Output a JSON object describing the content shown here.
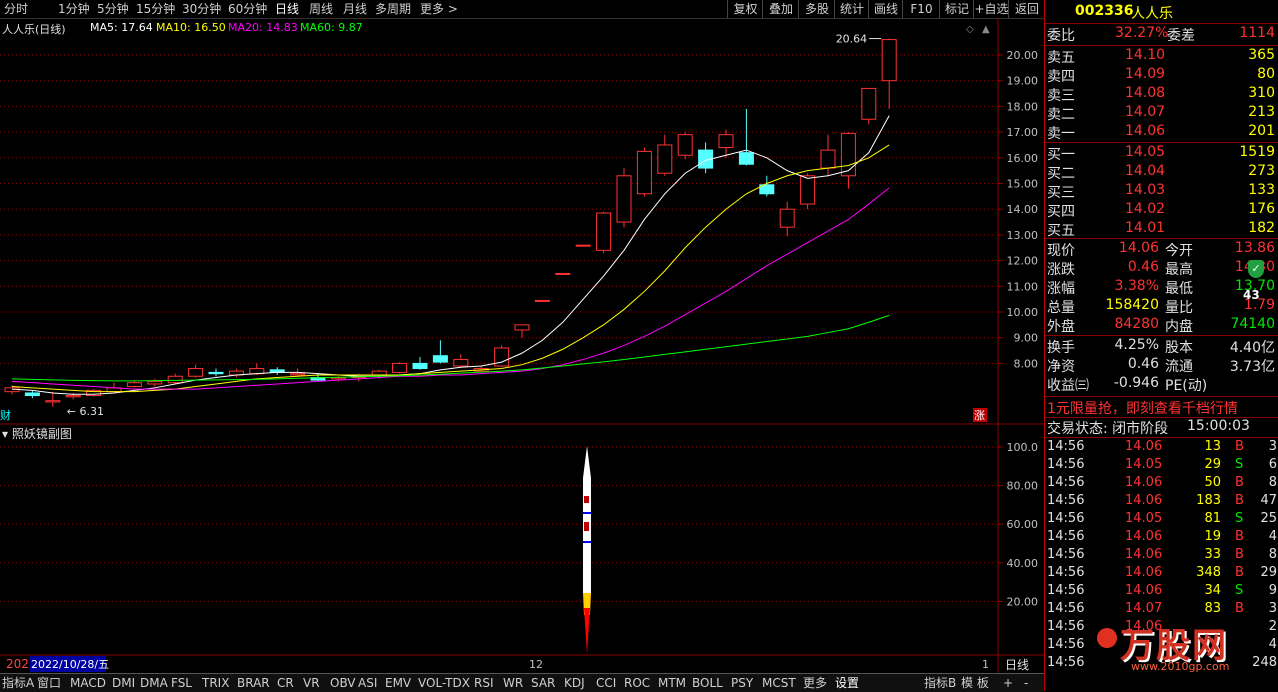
{
  "toolbar": {
    "periods": [
      "分时",
      "1分钟",
      "5分钟",
      "15分钟",
      "30分钟",
      "60分钟",
      "日线",
      "周线",
      "月线",
      "多周期",
      "更多 >"
    ],
    "buttons": [
      "复权",
      "叠加",
      "多股",
      "统计",
      "画线",
      "F10",
      "标记",
      "+自选",
      "返回"
    ]
  },
  "main_chart": {
    "title": "人人乐(日线)",
    "ma": [
      {
        "label": "MA5: 17.64",
        "color": "#ffffff"
      },
      {
        "label": "MA10: 16.50",
        "color": "#ffff00"
      },
      {
        "label": "MA20: 14.83",
        "color": "#ff00ff"
      },
      {
        "label": "MA60: 9.87",
        "color": "#00ff00"
      }
    ],
    "high_label": "20.64",
    "low_label": "6.31",
    "y_ticks": [
      "20.00",
      "19.00",
      "18.00",
      "17.00",
      "16.00",
      "15.00",
      "14.00",
      "13.00",
      "12.00",
      "11.00",
      "10.00",
      "9.00",
      "8.00"
    ],
    "marker_cai": "财",
    "marker_zhang": "涨"
  },
  "sub_chart": {
    "title": "照妖镜副图",
    "y_ticks": [
      "100.0",
      "80.00",
      "60.00",
      "40.00",
      "20.00"
    ]
  },
  "time_axis": {
    "left_label": "202",
    "date_label": "2022/10/28/五",
    "month_12": "12",
    "month_1": "1",
    "period_label": "日线"
  },
  "bottom_tabs": [
    "指标A",
    "窗口",
    "MACD",
    "DMI",
    "DMA",
    "FSL",
    "TRIX",
    "BRAR",
    "CR",
    "VR",
    "OBV",
    "ASI",
    "EMV",
    "VOL-TDX",
    "RSI",
    "WR",
    "SAR",
    "KDJ",
    "CCI",
    "ROC",
    "MTM",
    "BOLL",
    "PSY",
    "MCST",
    "更多",
    "设置"
  ],
  "bottom_right": [
    "指标B",
    "模 板",
    "+",
    "-",
    "I",
    "+",
    "-"
  ],
  "quote": {
    "code": "002336",
    "name": "人人乐",
    "weibi_label": "委比",
    "weibi": "32.27%",
    "weicha_label": "委差",
    "weicha": "1114",
    "asks": [
      {
        "label": "卖五",
        "price": "14.10",
        "vol": "365"
      },
      {
        "label": "卖四",
        "price": "14.09",
        "vol": "80"
      },
      {
        "label": "卖三",
        "price": "14.08",
        "vol": "310"
      },
      {
        "label": "卖二",
        "price": "14.07",
        "vol": "213"
      },
      {
        "label": "卖一",
        "price": "14.06",
        "vol": "201"
      }
    ],
    "bids": [
      {
        "label": "买一",
        "price": "14.05",
        "vol": "1519"
      },
      {
        "label": "买二",
        "price": "14.04",
        "vol": "273"
      },
      {
        "label": "买三",
        "price": "14.03",
        "vol": "133"
      },
      {
        "label": "买四",
        "price": "14.02",
        "vol": "176"
      },
      {
        "label": "买五",
        "price": "14.01",
        "vol": "182"
      }
    ],
    "stats": [
      {
        "l1": "现价",
        "v1": "14.06",
        "l2": "今开",
        "v2": "13.86"
      },
      {
        "l1": "涨跌",
        "v1": "0.46",
        "l2": "最高",
        "v2": "14.30"
      },
      {
        "l1": "涨幅",
        "v1": "3.38%",
        "l2": "最低",
        "v2": "13.70"
      },
      {
        "l1": "总量",
        "v1": "158420",
        "l2": "量比",
        "v2": "1.79"
      },
      {
        "l1": "外盘",
        "v1": "84280",
        "l2": "内盘",
        "v2": "74140"
      }
    ],
    "stats2": [
      {
        "l1": "换手",
        "v1": "4.25%",
        "l2": "股本",
        "v2": "4.40亿"
      },
      {
        "l1": "净资",
        "v1": "0.46",
        "l2": "流通",
        "v2": "3.73亿"
      },
      {
        "l1": "收益㈢",
        "v1": "-0.946",
        "l2": "PE(动)",
        "v2": ""
      }
    ],
    "badge_pct": "43",
    "ad_text": "1元限量抢，即刻查看千档行情",
    "status_label": "交易状态: 闭市阶段",
    "status_time": "15:00:03",
    "ticks": [
      {
        "t": "14:56",
        "p": "14.06",
        "v": "13",
        "bs": "B",
        "n": "3"
      },
      {
        "t": "14:56",
        "p": "14.05",
        "v": "29",
        "bs": "S",
        "n": "6"
      },
      {
        "t": "14:56",
        "p": "14.06",
        "v": "50",
        "bs": "B",
        "n": "8"
      },
      {
        "t": "14:56",
        "p": "14.06",
        "v": "183",
        "bs": "B",
        "n": "47"
      },
      {
        "t": "14:56",
        "p": "14.05",
        "v": "81",
        "bs": "S",
        "n": "25"
      },
      {
        "t": "14:56",
        "p": "14.06",
        "v": "19",
        "bs": "B",
        "n": "4"
      },
      {
        "t": "14:56",
        "p": "14.06",
        "v": "33",
        "bs": "B",
        "n": "8"
      },
      {
        "t": "14:56",
        "p": "14.06",
        "v": "348",
        "bs": "B",
        "n": "29"
      },
      {
        "t": "14:56",
        "p": "14.06",
        "v": "34",
        "bs": "S",
        "n": "9"
      },
      {
        "t": "14:56",
        "p": "14.07",
        "v": "83",
        "bs": "B",
        "n": "3"
      },
      {
        "t": "14:56",
        "p": "14.06",
        "v": "",
        "bs": "",
        "n": "2"
      },
      {
        "t": "14:56",
        "p": "",
        "v": "",
        "bs": "",
        "n": "4"
      },
      {
        "t": "14:56",
        "p": "",
        "v": "",
        "bs": "",
        "n": "248"
      }
    ],
    "watermark": "万股网",
    "watermark_url": "www.2010gp.com"
  },
  "colors": {
    "up": "#ff3232",
    "down": "#54ffff",
    "ma5": "#ffffff",
    "ma10": "#ffff00",
    "ma20": "#ff00ff",
    "ma60": "#00ff00",
    "grid": "#8b0000"
  },
  "chart_data": {
    "type": "candlestick",
    "ylim": [
      6.0,
      21.0
    ],
    "candles": [
      {
        "o": 6.9,
        "c": 7.05,
        "h": 7.15,
        "l": 6.8
      },
      {
        "o": 6.85,
        "c": 6.75,
        "h": 6.95,
        "l": 6.65
      },
      {
        "o": 6.5,
        "c": 6.55,
        "h": 6.9,
        "l": 6.31
      },
      {
        "o": 6.7,
        "c": 6.75,
        "h": 6.85,
        "l": 6.6
      },
      {
        "o": 6.75,
        "c": 6.95,
        "h": 7.0,
        "l": 6.7
      },
      {
        "o": 6.9,
        "c": 7.05,
        "h": 7.25,
        "l": 6.85
      },
      {
        "o": 7.1,
        "c": 7.25,
        "h": 7.35,
        "l": 7.05
      },
      {
        "o": 7.2,
        "c": 7.3,
        "h": 7.4,
        "l": 7.1
      },
      {
        "o": 7.25,
        "c": 7.5,
        "h": 7.6,
        "l": 7.2
      },
      {
        "o": 7.5,
        "c": 7.8,
        "h": 7.95,
        "l": 7.45
      },
      {
        "o": 7.65,
        "c": 7.6,
        "h": 7.8,
        "l": 7.5
      },
      {
        "o": 7.55,
        "c": 7.7,
        "h": 7.8,
        "l": 7.45
      },
      {
        "o": 7.6,
        "c": 7.8,
        "h": 8.0,
        "l": 7.55
      },
      {
        "o": 7.75,
        "c": 7.65,
        "h": 7.85,
        "l": 7.55
      },
      {
        "o": 7.55,
        "c": 7.6,
        "h": 7.8,
        "l": 7.5
      },
      {
        "o": 7.45,
        "c": 7.35,
        "h": 7.6,
        "l": 7.3
      },
      {
        "o": 7.4,
        "c": 7.45,
        "h": 7.5,
        "l": 7.3
      },
      {
        "o": 7.45,
        "c": 7.55,
        "h": 7.6,
        "l": 7.3
      },
      {
        "o": 7.55,
        "c": 7.7,
        "h": 7.75,
        "l": 7.4
      },
      {
        "o": 7.65,
        "c": 8.0,
        "h": 8.05,
        "l": 7.6
      },
      {
        "o": 8.0,
        "c": 7.8,
        "h": 8.25,
        "l": 7.75
      },
      {
        "o": 8.3,
        "c": 8.05,
        "h": 8.9,
        "l": 8.0
      },
      {
        "o": 7.9,
        "c": 8.15,
        "h": 8.35,
        "l": 7.85
      },
      {
        "o": 7.7,
        "c": 7.8,
        "h": 7.9,
        "l": 7.65
      },
      {
        "o": 7.9,
        "c": 8.6,
        "h": 8.7,
        "l": 7.85
      },
      {
        "o": 9.3,
        "c": 9.5,
        "h": 9.5,
        "l": 9.0
      },
      {
        "o": 10.45,
        "c": 10.45,
        "h": 10.45,
        "l": 10.45
      },
      {
        "o": 11.5,
        "c": 11.5,
        "h": 11.5,
        "l": 11.5
      },
      {
        "o": 12.6,
        "c": 12.6,
        "h": 12.6,
        "l": 12.6
      },
      {
        "o": 12.4,
        "c": 13.85,
        "h": 13.9,
        "l": 12.3
      },
      {
        "o": 13.5,
        "c": 15.3,
        "h": 15.6,
        "l": 13.3
      },
      {
        "o": 14.6,
        "c": 16.25,
        "h": 16.4,
        "l": 14.5
      },
      {
        "o": 15.4,
        "c": 16.5,
        "h": 16.9,
        "l": 15.3
      },
      {
        "o": 16.1,
        "c": 16.9,
        "h": 17.0,
        "l": 15.95
      },
      {
        "o": 16.3,
        "c": 15.6,
        "h": 16.6,
        "l": 15.4
      },
      {
        "o": 16.4,
        "c": 16.9,
        "h": 17.1,
        "l": 16.0
      },
      {
        "o": 16.2,
        "c": 15.75,
        "h": 17.9,
        "l": 15.7
      },
      {
        "o": 14.95,
        "c": 14.6,
        "h": 15.3,
        "l": 14.5
      },
      {
        "o": 13.3,
        "c": 14.0,
        "h": 14.3,
        "l": 12.95
      },
      {
        "o": 14.2,
        "c": 15.3,
        "h": 15.4,
        "l": 14.0
      },
      {
        "o": 15.6,
        "c": 16.3,
        "h": 16.9,
        "l": 15.3
      },
      {
        "o": 15.3,
        "c": 16.95,
        "h": 17.0,
        "l": 14.8
      },
      {
        "o": 17.5,
        "c": 18.7,
        "h": 18.7,
        "l": 17.3
      },
      {
        "o": 19.0,
        "c": 20.6,
        "h": 20.64,
        "l": 17.9
      }
    ],
    "ma5": [
      7.0,
      6.95,
      6.85,
      6.8,
      6.8,
      6.85,
      6.95,
      7.05,
      7.2,
      7.35,
      7.45,
      7.55,
      7.6,
      7.65,
      7.65,
      7.6,
      7.55,
      7.5,
      7.5,
      7.55,
      7.6,
      7.75,
      7.85,
      7.9,
      8.05,
      8.4,
      8.9,
      9.6,
      10.5,
      11.4,
      12.4,
      13.6,
      14.6,
      15.4,
      15.9,
      16.1,
      16.3,
      16.0,
      15.5,
      15.2,
      15.3,
      15.5,
      16.2,
      17.64
    ],
    "ma10": [
      7.1,
      7.05,
      7.0,
      6.95,
      6.9,
      6.9,
      6.9,
      6.95,
      7.0,
      7.1,
      7.2,
      7.3,
      7.4,
      7.45,
      7.5,
      7.55,
      7.55,
      7.55,
      7.55,
      7.55,
      7.6,
      7.65,
      7.7,
      7.75,
      7.8,
      7.95,
      8.2,
      8.55,
      9.0,
      9.5,
      10.1,
      10.8,
      11.6,
      12.5,
      13.3,
      14.0,
      14.6,
      15.0,
      15.3,
      15.5,
      15.6,
      15.7,
      16.0,
      16.5
    ],
    "ma20": [
      7.3,
      7.25,
      7.2,
      7.15,
      7.1,
      7.05,
      7.0,
      7.0,
      7.0,
      7.0,
      7.05,
      7.1,
      7.15,
      7.2,
      7.25,
      7.3,
      7.35,
      7.4,
      7.45,
      7.5,
      7.5,
      7.55,
      7.55,
      7.6,
      7.65,
      7.7,
      7.8,
      7.95,
      8.15,
      8.4,
      8.7,
      9.05,
      9.45,
      9.9,
      10.35,
      10.8,
      11.3,
      11.8,
      12.25,
      12.7,
      13.15,
      13.6,
      14.2,
      14.83
    ],
    "ma60": [
      7.4,
      7.38,
      7.36,
      7.34,
      7.33,
      7.32,
      7.32,
      7.33,
      7.34,
      7.35,
      7.36,
      7.37,
      7.38,
      7.4,
      7.42,
      7.44,
      7.46,
      7.48,
      7.5,
      7.52,
      7.55,
      7.58,
      7.62,
      7.66,
      7.7,
      7.75,
      7.82,
      7.9,
      7.98,
      8.06,
      8.15,
      8.25,
      8.35,
      8.45,
      8.55,
      8.65,
      8.75,
      8.85,
      8.95,
      9.05,
      9.2,
      9.35,
      9.6,
      9.87
    ]
  }
}
